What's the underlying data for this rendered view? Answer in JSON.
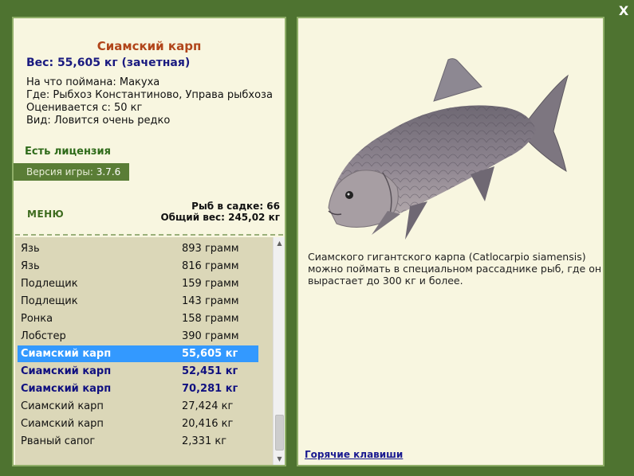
{
  "close_label": "X",
  "fish": {
    "title": "Сиамский карп",
    "weight": "Вес: 55,605 кг (зачетная)",
    "bait": "На что поймана: Макуха",
    "location": "Где: Рыбхоз Константиново, Управа рыбхоза",
    "price": "Оценивается с: 50 кг",
    "rarity": "Вид: Ловится очень редко"
  },
  "license": "Есть лицензия",
  "version": {
    "label": "Версия игры:",
    "value": "3.7.6"
  },
  "menu_label": "МЕНЮ",
  "keepnet": {
    "count": "Рыб в садке: 66",
    "total": "Общий вес: 245,02 кг"
  },
  "catch_list": [
    {
      "name": "Язь",
      "weight": "893 грамм",
      "state": "normal"
    },
    {
      "name": "Язь",
      "weight": "816 грамм",
      "state": "normal"
    },
    {
      "name": "Подлещик",
      "weight": "159 грамм",
      "state": "normal"
    },
    {
      "name": "Подлещик",
      "weight": "143 грамм",
      "state": "normal"
    },
    {
      "name": "Ронка",
      "weight": "158 грамм",
      "state": "normal"
    },
    {
      "name": "Лобстер",
      "weight": "390 грамм",
      "state": "normal"
    },
    {
      "name": "Сиамский карп",
      "weight": "55,605 кг",
      "state": "selected"
    },
    {
      "name": "Сиамский карп",
      "weight": "52,451 кг",
      "state": "bold"
    },
    {
      "name": "Сиамский карп",
      "weight": "70,281 кг",
      "state": "bold"
    },
    {
      "name": "Сиамский карп",
      "weight": "27,424 кг",
      "state": "normal"
    },
    {
      "name": "Сиамский карп",
      "weight": "20,416 кг",
      "state": "normal"
    },
    {
      "name": "Рваный сапог",
      "weight": "2,331 кг",
      "state": "normal"
    }
  ],
  "description": "Сиамского гигантского карпа (Catlocarpio siamensis) можно поймать в специальном рассаднике рыб, где он вырастает до 300 кг и более.",
  "hotkeys_label": "Горячие клавиши",
  "colors": {
    "background": "#4e7330",
    "panel": "#f8f6e0",
    "title": "#b1451a",
    "selected": "#3399ff",
    "list_bg": "#dbd7b8"
  }
}
